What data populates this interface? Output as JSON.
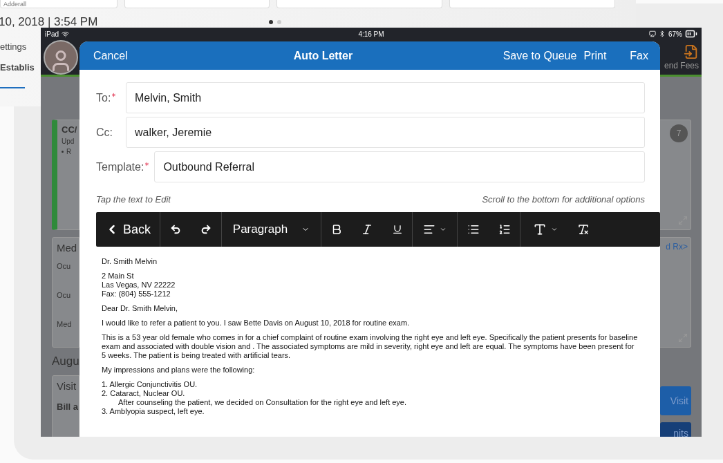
{
  "background_app": {
    "top_text": "Adderall",
    "date": "10, 2018 | 3:54 PM",
    "menu": [
      "ettings",
      "Establis"
    ],
    "pager": [
      {
        "selected": true
      },
      {
        "selected": false
      }
    ]
  },
  "status_bar": {
    "device": "iPad",
    "time": "4:16 PM",
    "battery": "67%"
  },
  "app_header": {
    "action": "end Fees"
  },
  "left_panel": {
    "cc_title": "CC/",
    "cc_sub": "Upd",
    "cc_bullet": "R",
    "med_title": "Med",
    "med_rows": [
      "Ocu",
      "Ocu",
      "Med"
    ],
    "section": "Augu",
    "visit_title": "Visit",
    "visit_row": "Bill a"
  },
  "right_panel": {
    "badge": "7",
    "link": "d Rx>",
    "buttons": [
      {
        "label": "Visit",
        "kind": "primary"
      },
      {
        "label": "nits",
        "kind": "dark"
      }
    ]
  },
  "modal": {
    "cancel": "Cancel",
    "title": "Auto Letter",
    "actions": [
      "Save to Queue",
      "Print",
      "Fax"
    ],
    "fields": [
      {
        "label": "To:",
        "required": true,
        "value": "Melvin, Smith"
      },
      {
        "label": "Cc:",
        "required": false,
        "value": "walker, Jeremie"
      },
      {
        "label": "Template:",
        "required": true,
        "value": "Outbound Referral"
      }
    ],
    "hint_left": "Tap the text to Edit",
    "hint_right": "Scroll to the bottom for additional options",
    "toolbar": {
      "back": "Back",
      "format": "Paragraph"
    },
    "letter": [
      {
        "lines": [
          "Dr. Smith Melvin"
        ]
      },
      {
        "lines": [
          "2 Main St",
          "Las Vegas, NV 22222",
          "Fax: (804) 555-1212"
        ]
      },
      {
        "lines": [
          "Dear Dr. Smith Melvin,"
        ]
      },
      {
        "lines": [
          "I would like to refer a patient to you. I saw Bette Davis on August 10, 2018 for routine exam."
        ]
      },
      {
        "lines": [
          "This is a 53 year old female who comes in for a chief complaint of routine exam involving the right eye and left eye. Specifically the patient presents for baseline exam and associated with double vision and . The associated symptoms are mild in severity, right eye and left are equal. The symptoms have been present for 5 weeks. The patient is being treated with artificial tears."
        ]
      },
      {
        "lines": [
          "My impressions and plans were the following:"
        ]
      }
    ],
    "plan": [
      {
        "kind": "item",
        "text": "1. Allergic Conjunctivitis OU."
      },
      {
        "kind": "item",
        "text": "2. Cataract, Nuclear OU."
      },
      {
        "kind": "note",
        "text": "After counseling the patient, we decided on Consultation for the right eye and left eye."
      },
      {
        "kind": "item",
        "text": "3. Amblyopia suspect, left eye."
      }
    ]
  }
}
